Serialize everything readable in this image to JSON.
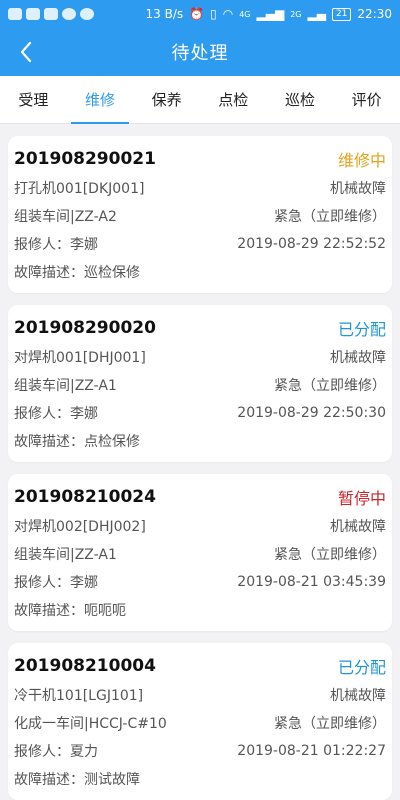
{
  "status_bar": {
    "net_speed": "13 B/s",
    "signal_4g": "4G",
    "signal_2g": "2G",
    "battery": "21",
    "time": "22:30"
  },
  "header": {
    "title": "待处理",
    "back_icon": "chevron-left-icon"
  },
  "tabs": [
    {
      "label": "受理",
      "active": false
    },
    {
      "label": "维修",
      "active": true
    },
    {
      "label": "保养",
      "active": false
    },
    {
      "label": "点检",
      "active": false
    },
    {
      "label": "巡检",
      "active": false
    },
    {
      "label": "评价",
      "active": false
    }
  ],
  "colors": {
    "primary": "#2d9bf0",
    "status_repairing": "#e3a31c",
    "status_assigned": "#1f95d6",
    "status_paused": "#c9252a"
  },
  "orders": [
    {
      "id": "201908290021",
      "status": "维修中",
      "status_color": "#e3a31c",
      "equipment": "打孔机001[DKJ001]",
      "fault_type": "机械故障",
      "location": "组装车间|ZZ-A2",
      "urgency": "紧急（立即维修）",
      "reporter": "报修人：李娜",
      "time": "2019-08-29 22:52:52",
      "description": "故障描述：巡检保修"
    },
    {
      "id": "201908290020",
      "status": "已分配",
      "status_color": "#1f95d6",
      "equipment": "对焊机001[DHJ001]",
      "fault_type": "机械故障",
      "location": "组装车间|ZZ-A1",
      "urgency": "紧急（立即维修）",
      "reporter": "报修人：李娜",
      "time": "2019-08-29 22:50:30",
      "description": "故障描述：点检保修"
    },
    {
      "id": "201908210024",
      "status": "暂停中",
      "status_color": "#c9252a",
      "equipment": "对焊机002[DHJ002]",
      "fault_type": "机械故障",
      "location": "组装车间|ZZ-A1",
      "urgency": "紧急（立即维修）",
      "reporter": "报修人：李娜",
      "time": "2019-08-21 03:45:39",
      "description": "故障描述：呃呃呃"
    },
    {
      "id": "201908210004",
      "status": "已分配",
      "status_color": "#1f95d6",
      "equipment": "冷干机101[LGJ101]",
      "fault_type": "机械故障",
      "location": "化成一车间|HCCJ-C#10",
      "urgency": "紧急（立即维修）",
      "reporter": "报修人：夏力",
      "time": "2019-08-21 01:22:27",
      "description": "故障描述：测试故障"
    }
  ]
}
